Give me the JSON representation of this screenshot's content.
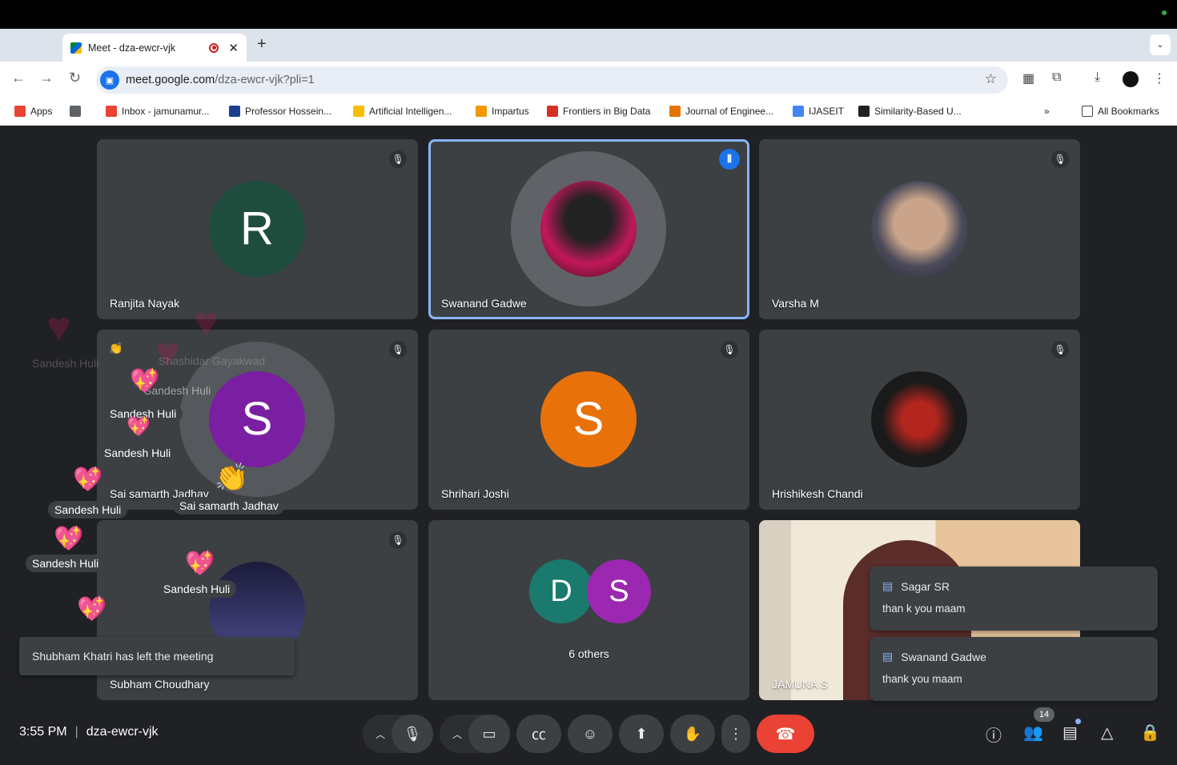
{
  "browser": {
    "tab_title": "Meet - dza-ewcr-vjk",
    "tab_close": "✕",
    "new_tab": "+",
    "url_host": "meet.google.com",
    "url_path": "/dza-ewcr-vjk?pli=1"
  },
  "bookmarks": [
    {
      "label": "Apps",
      "icon": "apps-grid-icon",
      "color": "#ea4335"
    },
    {
      "label": "",
      "icon": "grid-icon",
      "color": "#5f6368"
    },
    {
      "label": "Inbox - jamunamur...",
      "icon": "gmail-icon",
      "color": "#ea4335"
    },
    {
      "label": "Professor Hossein...",
      "icon": "s-icon",
      "color": "#1a3f8f"
    },
    {
      "label": "Artificial Intelligen...",
      "icon": "drive-icon",
      "color": "#fbbc04"
    },
    {
      "label": "Impartus",
      "icon": "star-icon",
      "color": "#f29900"
    },
    {
      "label": "Frontiers in Big Data",
      "icon": "frontiers-icon",
      "color": "#d93025"
    },
    {
      "label": "Journal of Enginee...",
      "icon": "sjr-icon",
      "color": "#e37400"
    },
    {
      "label": "IJASEIT",
      "icon": "ijaseit-icon",
      "color": "#4285f4"
    },
    {
      "label": "Similarity-Based U...",
      "icon": "similarity-icon",
      "color": "#202124"
    }
  ],
  "bookmarks_more": "»",
  "all_bookmarks": "All Bookmarks",
  "tiles": [
    {
      "name": "Ranjita Nayak",
      "initial": "R",
      "color": "#1e4d3e",
      "muted": true
    },
    {
      "name": "Swanand Gadwe",
      "initial": "",
      "color": "#5f6368",
      "muted": false,
      "speaking": true
    },
    {
      "name": "Varsha M",
      "initial": "",
      "color": "#6a5a4a",
      "muted": true
    },
    {
      "name": "Sai samarth Jadhav",
      "initial": "S",
      "color": "#7b1fa2",
      "muted": true
    },
    {
      "name": "Shrihari Joshi",
      "initial": "S",
      "color": "#e8710a",
      "muted": true
    },
    {
      "name": "Hrishikesh Chandi",
      "initial": "",
      "color": "#1a1a1a",
      "muted": true
    },
    {
      "name": "Subham Choudhary",
      "initial": "",
      "color": "#2a2a5a",
      "muted": true
    },
    {
      "name": "6 others",
      "initial": "",
      "color": "",
      "muted": false
    },
    {
      "name": "JAMUNA S",
      "initial": "",
      "color": "",
      "muted": false
    }
  ],
  "others": {
    "d": "D",
    "s": "S",
    "d_color": "#1a7a6e",
    "s_color": "#9c27b0"
  },
  "reactions": {
    "sandesh": "Sandesh Huli",
    "sai": "Sai samarth Jadhav",
    "shashidar": "Shashidar Gayakwad",
    "heart": "💖",
    "faded_heart": "♥",
    "clap": "👏"
  },
  "toast": "Shubham Khatri has left the meeting",
  "chats": [
    {
      "who": "Sagar SR",
      "msg": "than k you maam"
    },
    {
      "who": "Swanand Gadwe",
      "msg": "thank you maam"
    }
  ],
  "footer": {
    "time": "3:55 PM",
    "sep": "|",
    "code": "dza-ewcr-vjk",
    "people_count": "14"
  }
}
